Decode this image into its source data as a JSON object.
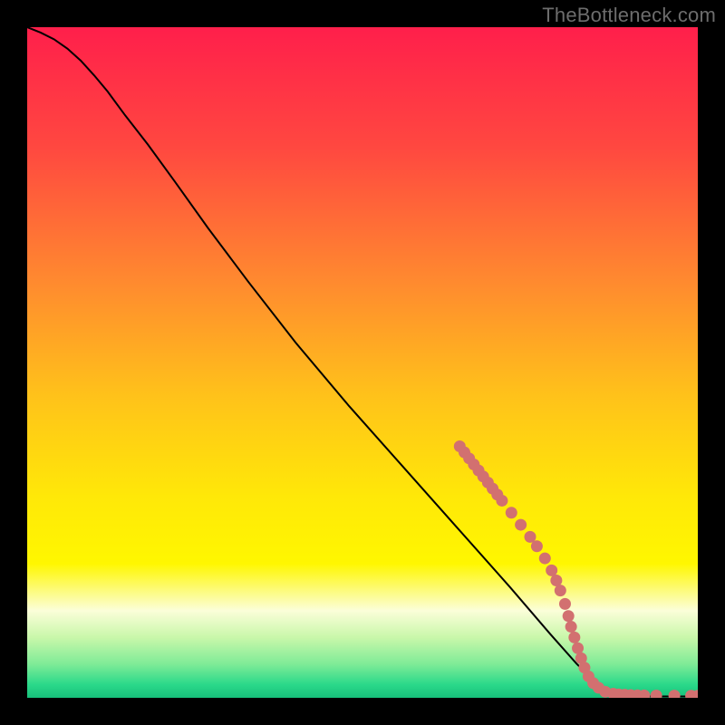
{
  "watermark": "TheBottleneck.com",
  "chart_data": {
    "type": "line",
    "title": "",
    "xlabel": "",
    "ylabel": "",
    "xlim": [
      0,
      100
    ],
    "ylim": [
      0,
      100
    ],
    "grid": false,
    "legend": false,
    "background_gradient_stops": [
      {
        "offset": 0.0,
        "color": "#ff1f4b"
      },
      {
        "offset": 0.18,
        "color": "#ff4840"
      },
      {
        "offset": 0.38,
        "color": "#ff8a2f"
      },
      {
        "offset": 0.55,
        "color": "#ffc21a"
      },
      {
        "offset": 0.7,
        "color": "#ffe808"
      },
      {
        "offset": 0.8,
        "color": "#fff700"
      },
      {
        "offset": 0.87,
        "color": "#fbfed9"
      },
      {
        "offset": 0.91,
        "color": "#c9f7aa"
      },
      {
        "offset": 0.95,
        "color": "#7eeb97"
      },
      {
        "offset": 0.98,
        "color": "#2bd98a"
      },
      {
        "offset": 1.0,
        "color": "#17c07b"
      }
    ],
    "series": [
      {
        "name": "bottleneck-curve",
        "type": "line",
        "stroke": "#000000",
        "points": [
          {
            "x": 0.0,
            "y": 100.0
          },
          {
            "x": 2.0,
            "y": 99.2
          },
          {
            "x": 4.0,
            "y": 98.2
          },
          {
            "x": 6.0,
            "y": 96.8
          },
          {
            "x": 8.0,
            "y": 95.0
          },
          {
            "x": 10.0,
            "y": 92.8
          },
          {
            "x": 12.0,
            "y": 90.4
          },
          {
            "x": 14.5,
            "y": 87.0
          },
          {
            "x": 18.0,
            "y": 82.5
          },
          {
            "x": 22.0,
            "y": 77.0
          },
          {
            "x": 27.0,
            "y": 70.0
          },
          {
            "x": 33.0,
            "y": 62.0
          },
          {
            "x": 40.0,
            "y": 53.0
          },
          {
            "x": 48.0,
            "y": 43.5
          },
          {
            "x": 56.0,
            "y": 34.5
          },
          {
            "x": 64.0,
            "y": 25.5
          },
          {
            "x": 72.0,
            "y": 16.5
          },
          {
            "x": 78.0,
            "y": 9.5
          },
          {
            "x": 82.0,
            "y": 5.0
          },
          {
            "x": 85.0,
            "y": 2.0
          },
          {
            "x": 87.5,
            "y": 0.7
          },
          {
            "x": 90.0,
            "y": 0.3
          },
          {
            "x": 94.0,
            "y": 0.2
          },
          {
            "x": 100.0,
            "y": 0.2
          }
        ]
      },
      {
        "name": "hw-markers",
        "type": "scatter",
        "marker_color": "#d27070",
        "marker_radius_px": 6.5,
        "points": [
          {
            "x": 64.5,
            "y": 37.5
          },
          {
            "x": 65.2,
            "y": 36.6
          },
          {
            "x": 65.9,
            "y": 35.7
          },
          {
            "x": 66.6,
            "y": 34.8
          },
          {
            "x": 67.3,
            "y": 33.9
          },
          {
            "x": 68.0,
            "y": 33.0
          },
          {
            "x": 68.7,
            "y": 32.1
          },
          {
            "x": 69.4,
            "y": 31.2
          },
          {
            "x": 70.1,
            "y": 30.3
          },
          {
            "x": 70.8,
            "y": 29.4
          },
          {
            "x": 72.2,
            "y": 27.6
          },
          {
            "x": 73.6,
            "y": 25.8
          },
          {
            "x": 75.0,
            "y": 24.0
          },
          {
            "x": 76.0,
            "y": 22.6
          },
          {
            "x": 77.2,
            "y": 20.8
          },
          {
            "x": 78.2,
            "y": 19.0
          },
          {
            "x": 78.9,
            "y": 17.5
          },
          {
            "x": 79.5,
            "y": 16.0
          },
          {
            "x": 80.2,
            "y": 14.0
          },
          {
            "x": 80.7,
            "y": 12.2
          },
          {
            "x": 81.1,
            "y": 10.6
          },
          {
            "x": 81.6,
            "y": 9.0
          },
          {
            "x": 82.1,
            "y": 7.4
          },
          {
            "x": 82.6,
            "y": 5.9
          },
          {
            "x": 83.1,
            "y": 4.5
          },
          {
            "x": 83.7,
            "y": 3.2
          },
          {
            "x": 84.4,
            "y": 2.2
          },
          {
            "x": 85.2,
            "y": 1.5
          },
          {
            "x": 86.2,
            "y": 0.9
          },
          {
            "x": 87.4,
            "y": 0.6
          },
          {
            "x": 88.2,
            "y": 0.5
          },
          {
            "x": 89.1,
            "y": 0.45
          },
          {
            "x": 90.0,
            "y": 0.4
          },
          {
            "x": 91.0,
            "y": 0.38
          },
          {
            "x": 92.0,
            "y": 0.36
          },
          {
            "x": 93.8,
            "y": 0.34
          },
          {
            "x": 96.5,
            "y": 0.32
          },
          {
            "x": 99.0,
            "y": 0.3
          },
          {
            "x": 100.0,
            "y": 0.3
          }
        ]
      }
    ]
  }
}
